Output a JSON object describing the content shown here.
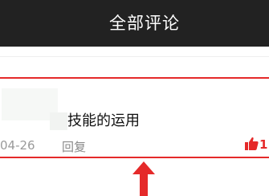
{
  "header": {
    "title": "全部评论"
  },
  "comment": {
    "text": "技能的运用",
    "date": "04-26",
    "reply_label": "回复",
    "like_count": "1"
  },
  "colors": {
    "header_bg": "#222222",
    "highlight": "#e52a2a",
    "like": "#e52a2a"
  },
  "icons": {
    "like": "thumbs-up-icon",
    "annotation": "up-arrow-icon"
  }
}
